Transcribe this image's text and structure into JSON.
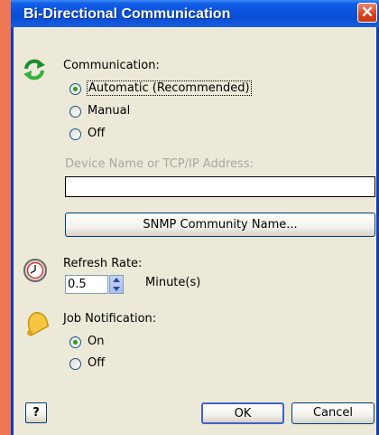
{
  "window": {
    "title": "Bi-Directional Communication",
    "close_glyph": "✕"
  },
  "communication": {
    "label": "Communication:",
    "options": [
      "Automatic (Recommended)",
      "Manual",
      "Off"
    ],
    "selected": "Automatic (Recommended)",
    "icon": "green-refresh-arrows-icon"
  },
  "device": {
    "label": "Device Name or TCP/IP Address:",
    "value": ""
  },
  "snmp_button": "SNMP Community Name...",
  "refresh": {
    "label": "Refresh Rate:",
    "value": "0.5",
    "unit": "Minute(s)",
    "icon": "clock-icon"
  },
  "job": {
    "label": "Job Notification:",
    "options": [
      "On",
      "Off"
    ],
    "selected": "On",
    "icon": "bell-icon"
  },
  "buttons": {
    "help": "?",
    "ok": "OK",
    "cancel": "Cancel"
  },
  "colors": {
    "titlebar": "#0a50d8",
    "dialog": "#ece9d8",
    "desktop": "#ee7755"
  }
}
